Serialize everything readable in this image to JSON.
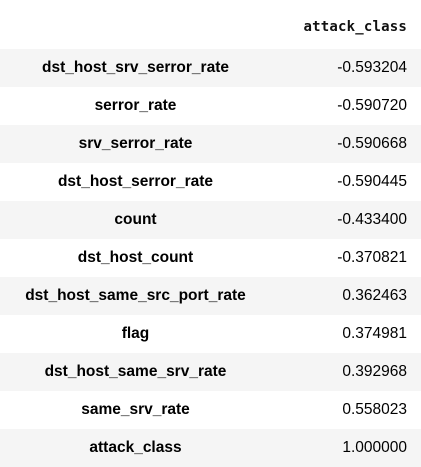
{
  "table": {
    "column_header": "attack_class",
    "rows": [
      {
        "index": "dst_host_srv_serror_rate",
        "value": "-0.593204"
      },
      {
        "index": "serror_rate",
        "value": "-0.590720"
      },
      {
        "index": "srv_serror_rate",
        "value": "-0.590668"
      },
      {
        "index": "dst_host_serror_rate",
        "value": "-0.590445"
      },
      {
        "index": "count",
        "value": "-0.433400"
      },
      {
        "index": "dst_host_count",
        "value": "-0.370821"
      },
      {
        "index": "dst_host_same_src_port_rate",
        "value": "0.362463"
      },
      {
        "index": "flag",
        "value": "0.374981"
      },
      {
        "index": "dst_host_same_srv_rate",
        "value": "0.392968"
      },
      {
        "index": "same_srv_rate",
        "value": "0.558023"
      },
      {
        "index": "attack_class",
        "value": "1.000000"
      }
    ]
  },
  "colors": {
    "stripe": "#f5f5f5",
    "header_border": "#bdbdbd"
  }
}
